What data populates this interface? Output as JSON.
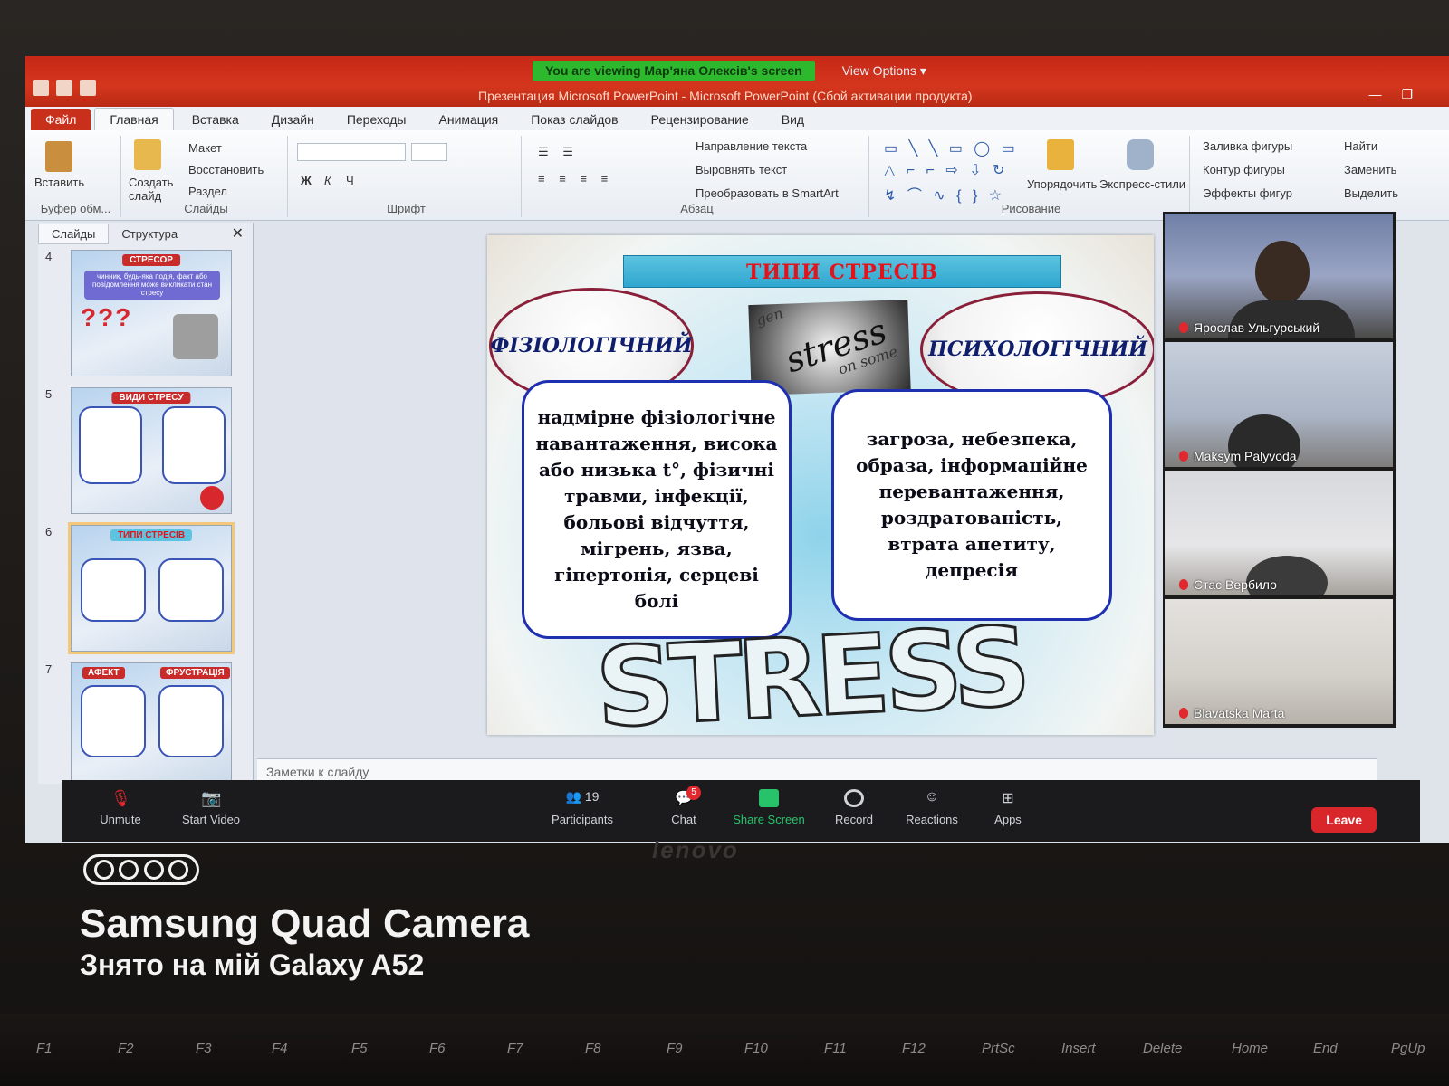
{
  "zoom": {
    "viewing_banner": "You are viewing Мар'яна Олексів's screen",
    "view_options": "View Options",
    "toolbar": {
      "unmute": "Unmute",
      "start_video": "Start Video",
      "participants": "Participants",
      "participants_count": "19",
      "chat": "Chat",
      "chat_badge": "5",
      "share_screen": "Share Screen",
      "record": "Record",
      "reactions": "Reactions",
      "apps": "Apps",
      "leave": "Leave"
    },
    "participants": [
      {
        "name": "Ярослав Ульгурський"
      },
      {
        "name": "Maksym Palyvoda"
      },
      {
        "name": "Стас Вербило"
      },
      {
        "name": "Blavatska Marta"
      }
    ]
  },
  "ppt": {
    "window_title": "Презентация Microsoft PowerPoint - Microsoft PowerPoint (Сбой активации продукта)",
    "tabs": [
      "Файл",
      "Главная",
      "Вставка",
      "Дизайн",
      "Переходы",
      "Анимация",
      "Показ слайдов",
      "Рецензирование",
      "Вид"
    ],
    "ribbon": {
      "paste": "Вставить",
      "clipboard": "Буфер обм...",
      "create_slide": "Создать слайд",
      "layout": "Макет",
      "reset": "Восстановить",
      "section": "Раздел",
      "slides_group": "Слайды",
      "font_group": "Шрифт",
      "paragraph_group": "Абзац",
      "text_direction": "Направление текста",
      "align_text": "Выровнять текст",
      "smartart": "Преобразовать в SmartArt",
      "arrange": "Упорядочить",
      "quick_styles": "Экспресс-стили",
      "drawing_group": "Рисование",
      "shape_fill": "Заливка фигуры",
      "shape_outline": "Контур фигуры",
      "shape_effects": "Эффекты фигур",
      "find": "Найти",
      "replace": "Заменить",
      "select": "Выделить"
    },
    "pane_tabs": [
      "Слайды",
      "Структура"
    ],
    "thumbnails": [
      {
        "num": "4",
        "title": "СТРЕСОР",
        "caption": "чинник, будь-яка подія, факт або повідомлення може викликати стан стресу"
      },
      {
        "num": "5",
        "title": "ВИДИ СТРЕСУ"
      },
      {
        "num": "6",
        "title": "ТИПИ СТРЕСІВ"
      },
      {
        "num": "7",
        "title_left": "АФЕКТ",
        "title_right": "ФРУСТРАЦІЯ"
      }
    ],
    "notes_placeholder": "Заметки к слайду",
    "slide": {
      "title": "ТИПИ СТРЕСІВ",
      "left_oval": "ФІЗІОЛОГІЧНИЙ",
      "right_oval": "ПСИХОЛОГІЧНИЙ",
      "image_word": "stress",
      "left_box": "надмірне фізіологічне навантаження, висока або низька t°, фізичні травми, інфекції, больові відчуття, мігрень, язва, гіпертонія, серцеві болі",
      "right_box": "загроза, небезпека, образа, інформаційне перевантаження, роздратованість, втрата апетиту, депресія",
      "graffiti": "STRESS"
    }
  },
  "watermark": {
    "title": "Samsung Quad Camera",
    "subtitle": "Знято на мій Galaxy A52"
  },
  "laptop_brand": "lenovo",
  "keyboard_keys": [
    "F1",
    "F2",
    "F3",
    "F4",
    "F5",
    "F6",
    "F7",
    "F8",
    "F9",
    "F10",
    "F11",
    "F12",
    "PrtSc",
    "Insert",
    "Delete",
    "Home",
    "End",
    "PgUp"
  ]
}
